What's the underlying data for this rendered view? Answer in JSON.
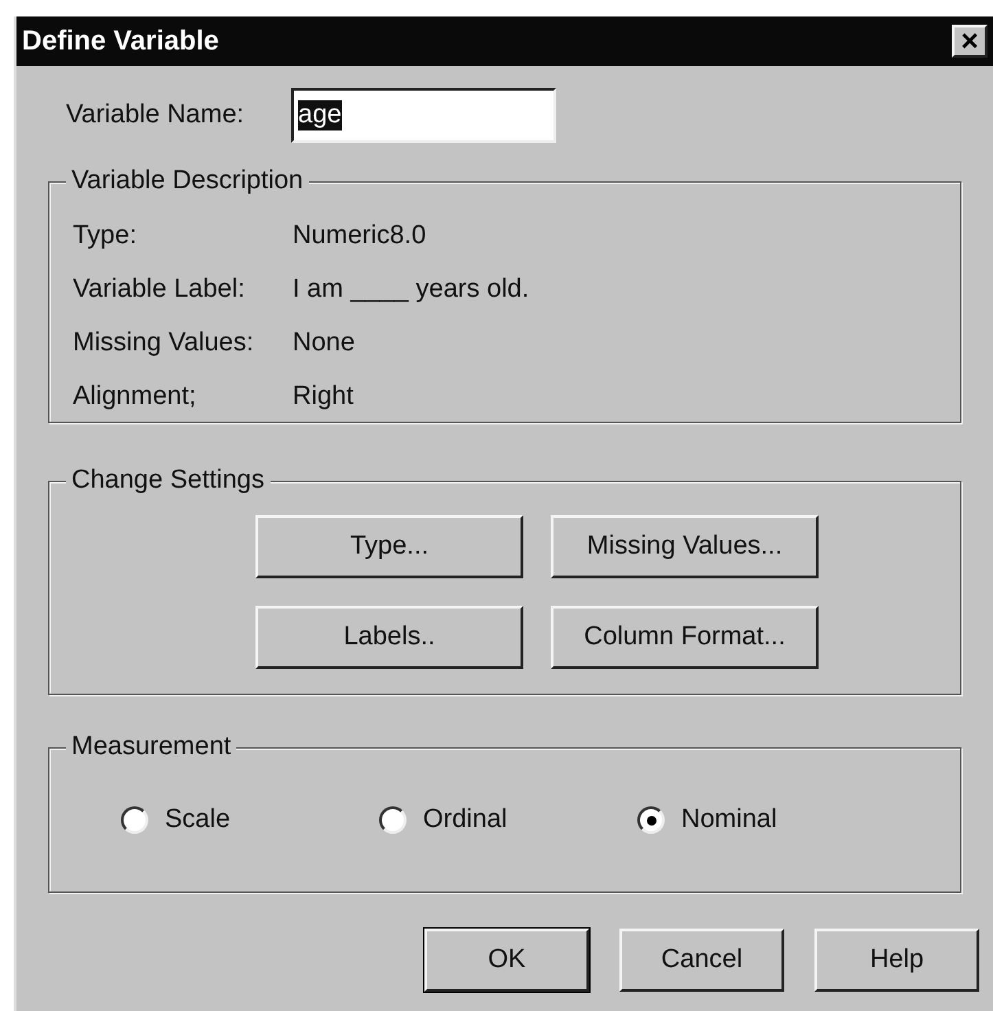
{
  "window": {
    "title": "Define Variable",
    "close": "×"
  },
  "variable_name": {
    "label": "Variable Name:",
    "value": "age",
    "selected": true
  },
  "description": {
    "title": "Variable Description",
    "rows": [
      {
        "label": "Type:",
        "value": "Numeric8.0"
      },
      {
        "label": "Variable Label:",
        "value": "I am ____ years old."
      },
      {
        "label": "Missing Values:",
        "value": "None"
      },
      {
        "label": "Alignment;",
        "value": "Right"
      }
    ]
  },
  "change_settings": {
    "title": "Change Settings",
    "buttons": [
      "Type...",
      "Missing Values...",
      "Labels..",
      "Column Format..."
    ]
  },
  "measurement": {
    "title": "Measurement",
    "options": [
      {
        "label": "Scale",
        "selected": false
      },
      {
        "label": "Ordinal",
        "selected": false
      },
      {
        "label": "Nominal",
        "selected": true
      }
    ]
  },
  "buttons": [
    {
      "label": "OK",
      "default": true
    },
    {
      "label": "Cancel",
      "default": false
    },
    {
      "label": "Help",
      "default": false
    }
  ]
}
